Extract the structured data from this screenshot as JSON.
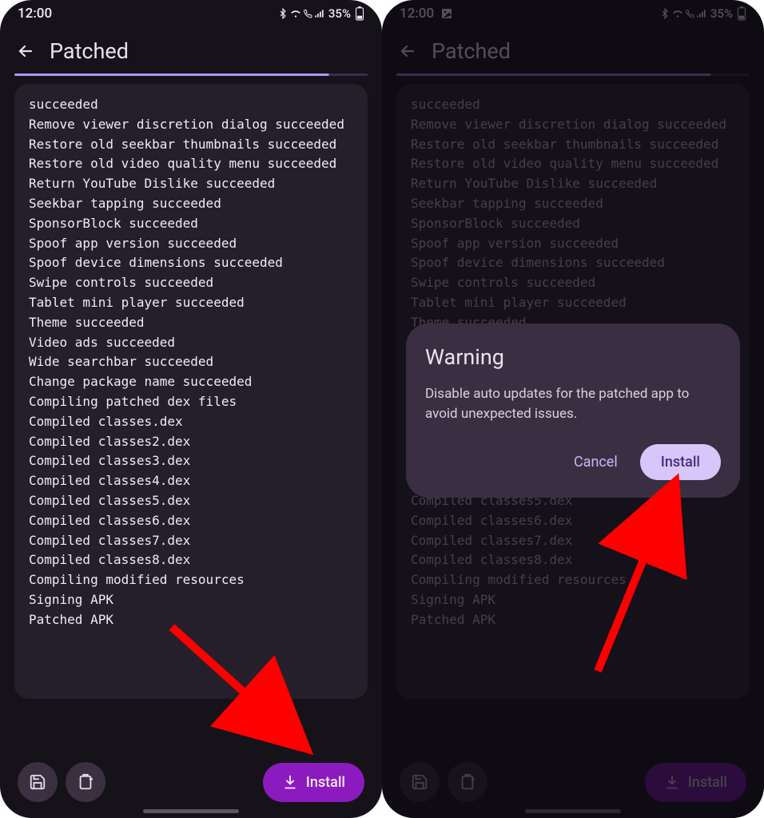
{
  "status": {
    "time": "12:00",
    "battery_pct": "35%"
  },
  "appbar": {
    "title": "Patched"
  },
  "log_lines": [
    "succeeded",
    "Remove viewer discretion dialog succeeded",
    "Restore old seekbar thumbnails succeeded",
    "Restore old video quality menu succeeded",
    "Return YouTube Dislike succeeded",
    "Seekbar tapping succeeded",
    "SponsorBlock succeeded",
    "Spoof app version succeeded",
    "Spoof device dimensions succeeded",
    "Swipe controls succeeded",
    "Tablet mini player succeeded",
    "Theme succeeded",
    "Video ads succeeded",
    "Wide searchbar succeeded",
    "Change package name succeeded",
    "Compiling patched dex files",
    "Compiled classes.dex",
    "Compiled classes2.dex",
    "Compiled classes3.dex",
    "Compiled classes4.dex",
    "Compiled classes5.dex",
    "Compiled classes6.dex",
    "Compiled classes7.dex",
    "Compiled classes8.dex",
    "Compiling modified resources",
    "Signing APK",
    "Patched APK"
  ],
  "bottom": {
    "install_label": "Install"
  },
  "dialog": {
    "title": "Warning",
    "body": "Disable auto updates for the patched app to avoid unexpected issues.",
    "cancel": "Cancel",
    "install": "Install"
  }
}
